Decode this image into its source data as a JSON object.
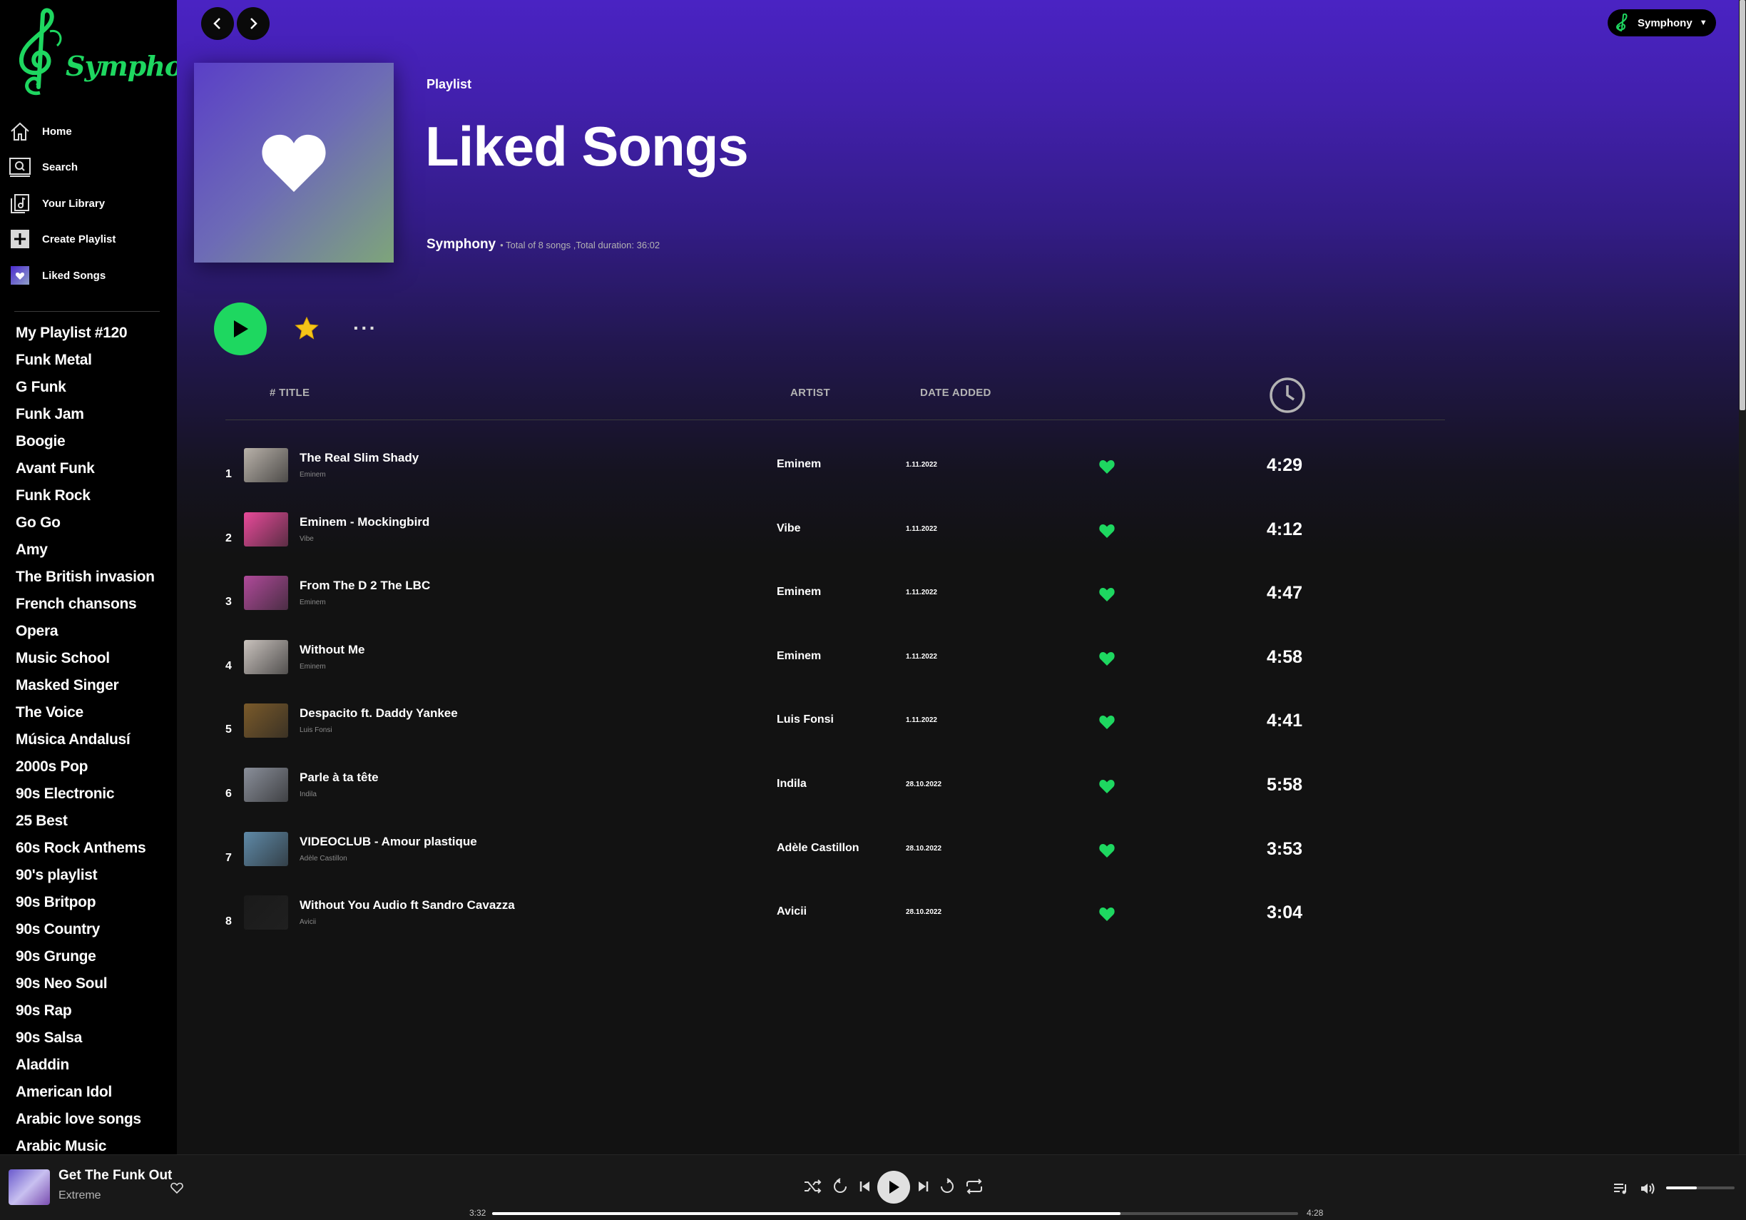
{
  "app": {
    "name": "Symphony"
  },
  "colors": {
    "accent": "#1ed760",
    "hero_top": "#4a23c3",
    "background": "#121212",
    "sidebar": "#000000"
  },
  "sidebar": {
    "nav": [
      {
        "label": "Home",
        "icon": "home-icon"
      },
      {
        "label": "Search",
        "icon": "search-icon"
      },
      {
        "label": "Your Library",
        "icon": "library-icon"
      },
      {
        "label": "Create Playlist",
        "icon": "plus-icon"
      },
      {
        "label": "Liked Songs",
        "icon": "heart-icon"
      }
    ],
    "playlists": [
      "My Playlist #120",
      "Funk Metal",
      "G Funk",
      "Funk Jam",
      "Boogie",
      "Avant Funk",
      "Funk Rock",
      "Go Go",
      "Amy",
      "The British invasion",
      "French chansons",
      "Opera",
      "Music School",
      "Masked Singer",
      "The Voice",
      "Música Andalusí",
      "2000s Pop",
      "90s Electronic",
      "25 Best",
      "60s Rock Anthems",
      "90's playlist",
      "90s Britpop",
      "90s Country",
      "90s Grunge",
      "90s Neo Soul",
      "90s Rap",
      "90s Salsa",
      "Aladdin",
      "American Idol",
      "Arabic love songs",
      "Arabic Music"
    ]
  },
  "header": {
    "user_label": "Symphony",
    "back_icon": "chevron-left-icon",
    "forward_icon": "chevron-right-icon"
  },
  "hero": {
    "type": "Playlist",
    "title": "Liked Songs",
    "owner": "Symphony",
    "summary": "• Total of 8 songs ,Total duration: 36:02"
  },
  "actions": {
    "play_icon": "play-icon",
    "star_icon": "star-icon",
    "more_label": "···"
  },
  "table": {
    "columns": {
      "title": "# TITLE",
      "artist": "ARTIST",
      "date": "DATE ADDED",
      "duration_icon": "clock-icon"
    },
    "rows": [
      {
        "num": "1",
        "title": "The Real Slim Shady",
        "sub": "Eminem",
        "artist": "Eminem",
        "date": "1.11.2022",
        "duration": "4:29",
        "thumb": "#b9b2aa"
      },
      {
        "num": "2",
        "title": "Eminem - Mockingbird",
        "sub": "Vibe",
        "artist": "Vibe",
        "date": "1.11.2022",
        "duration": "4:12",
        "thumb": "#e84a9a"
      },
      {
        "num": "3",
        "title": "From The D 2 The LBC",
        "sub": "Eminem",
        "artist": "Eminem",
        "date": "1.11.2022",
        "duration": "4:47",
        "thumb": "#b04a9a"
      },
      {
        "num": "4",
        "title": "Without Me",
        "sub": "Eminem",
        "artist": "Eminem",
        "date": "1.11.2022",
        "duration": "4:58",
        "thumb": "#c9c2bd"
      },
      {
        "num": "5",
        "title": "Despacito ft. Daddy Yankee",
        "sub": "Luis Fonsi",
        "artist": "Luis Fonsi",
        "date": "1.11.2022",
        "duration": "4:41",
        "thumb": "#7a5a2a"
      },
      {
        "num": "6",
        "title": "Parle à ta tête",
        "sub": "Indila",
        "artist": "Indila",
        "date": "28.10.2022",
        "duration": "5:58",
        "thumb": "#8a8f9a"
      },
      {
        "num": "7",
        "title": "VIDEOCLUB - Amour plastique",
        "sub": "Adèle Castillon",
        "artist": "Adèle Castillon",
        "date": "28.10.2022",
        "duration": "3:53",
        "thumb": "#5f8aa8"
      },
      {
        "num": "8",
        "title": "Without You Audio ft Sandro Cavazza",
        "sub": "Avicii",
        "artist": "Avicii",
        "date": "28.10.2022",
        "duration": "3:04",
        "thumb": "#1a1a1a"
      }
    ]
  },
  "player": {
    "title": "Get The Funk Out",
    "artist": "Extreme",
    "current_time": "3:32",
    "total_time": "4:28",
    "progress": 0.78,
    "volume": 0.45
  }
}
